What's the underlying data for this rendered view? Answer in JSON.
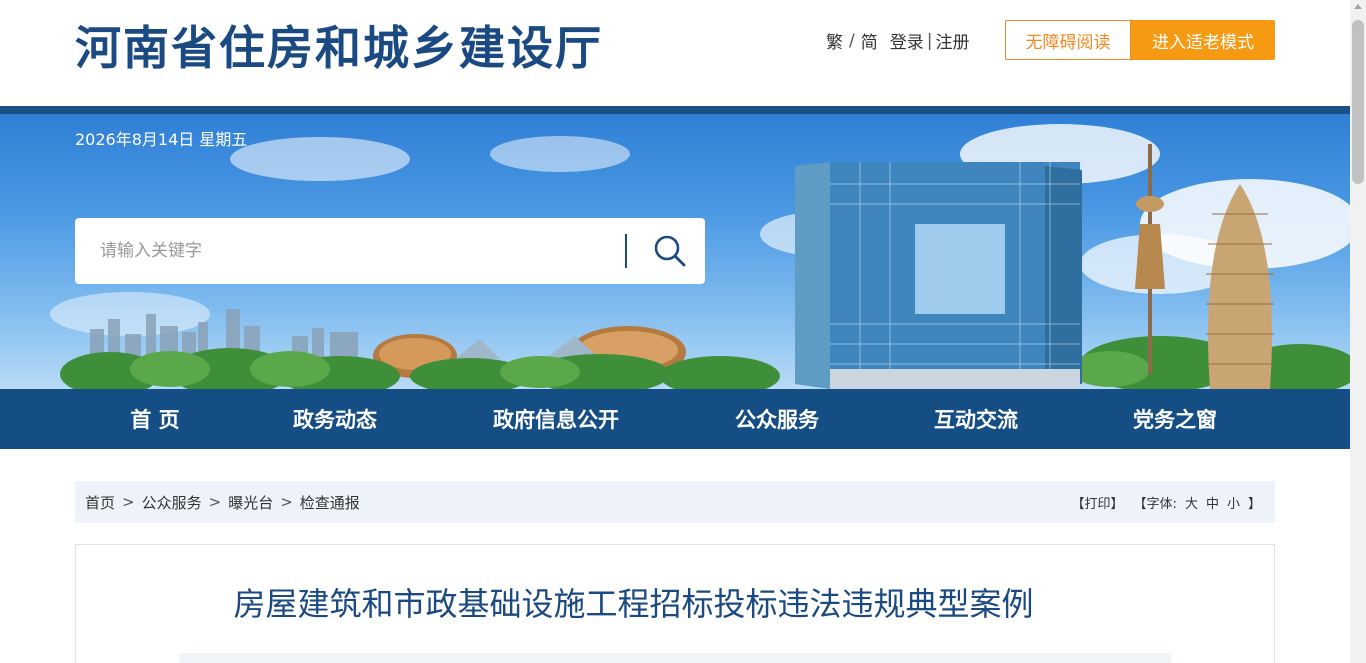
{
  "header": {
    "site_title": "河南省住房和城乡建设厅",
    "links": {
      "traditional": "繁",
      "slash": "/",
      "simplified": "简",
      "login": "登录",
      "bar": "|",
      "register": "注册"
    },
    "accessible_button": "无障碍阅读",
    "elder_mode_button": "进入适老模式",
    "colors": {
      "title": "#1b4a82",
      "accent": "#f59a12"
    }
  },
  "banner": {
    "date": "2026年8月14日 星期五",
    "search": {
      "placeholder": "请输入关键字",
      "icon": "search-icon"
    }
  },
  "nav": {
    "items": [
      {
        "label": "首 页"
      },
      {
        "label": "政务动态"
      },
      {
        "label": "政府信息公开"
      },
      {
        "label": "公众服务"
      },
      {
        "label": "互动交流"
      },
      {
        "label": "党务之窗"
      }
    ],
    "color": "#154d85"
  },
  "breadcrumb": {
    "items": [
      "首页",
      "公众服务",
      "曝光台",
      "检查通报"
    ],
    "separator": ">"
  },
  "tools": {
    "print": "【打印】",
    "font_open": "【字体:",
    "large": "大",
    "medium": "中",
    "small": "小",
    "font_close": "】"
  },
  "article": {
    "title": "房屋建筑和市政基础设施工程招标投标违法违规典型案例"
  },
  "share_icons": [
    {
      "name": "wechat-share-icon",
      "color": "#3cb34a"
    },
    {
      "name": "weibo-share-icon",
      "color": "#e8686a"
    },
    {
      "name": "qzone-share-icon",
      "color": "#f5b51c"
    }
  ]
}
